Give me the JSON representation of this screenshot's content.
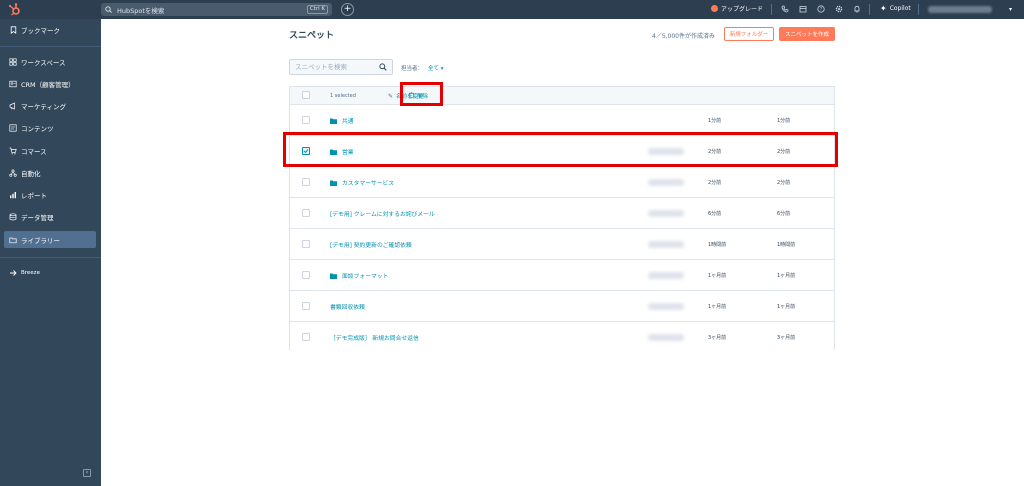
{
  "topbar": {
    "search_placeholder": "HubSpotを検索",
    "search_shortcut": "Ctrl K",
    "upgrade_label": "アップグレード",
    "copilot_label": "Copilot",
    "account_caret": "▾"
  },
  "sidebar": {
    "items": [
      {
        "label": "ブックマーク",
        "icon": "bookmark-icon"
      },
      {
        "label": "ワークスペース",
        "icon": "workspace-icon"
      },
      {
        "label": "CRM（顧客管理）",
        "icon": "crm-icon"
      },
      {
        "label": "マーケティング",
        "icon": "megaphone-icon"
      },
      {
        "label": "コンテンツ",
        "icon": "content-icon"
      },
      {
        "label": "コマース",
        "icon": "cart-icon"
      },
      {
        "label": "自動化",
        "icon": "automation-icon"
      },
      {
        "label": "レポート",
        "icon": "report-icon"
      },
      {
        "label": "データ管理",
        "icon": "database-icon"
      },
      {
        "label": "ライブラリー",
        "icon": "folder-icon"
      },
      {
        "label": "Breeze",
        "icon": "breeze-icon"
      }
    ],
    "active_index": 9
  },
  "page": {
    "title": "スニペット",
    "usage": "4／5,000件が作成済み",
    "new_folder_label": "新規フォルダー",
    "create_label": "スニペットを作成"
  },
  "filters": {
    "search_placeholder": "スニペットを検索",
    "owner_label": "担当者：",
    "owner_value": "全て ▾"
  },
  "table": {
    "selected_text": "1 selected",
    "rename_label": "名前を変更",
    "delete_label": "削除",
    "rows": [
      {
        "name": "共通",
        "folder": true,
        "checked": false,
        "created": "1分前",
        "updated": "1分前",
        "blurred": false
      },
      {
        "name": "営業",
        "folder": true,
        "checked": true,
        "created": "2分前",
        "updated": "2分前",
        "blurred": true
      },
      {
        "name": "カスタマーサービス",
        "folder": true,
        "checked": false,
        "created": "2分前",
        "updated": "2分前",
        "blurred": true
      },
      {
        "name": "[デモ用] クレームに対するお詫びメール",
        "folder": false,
        "checked": false,
        "created": "6分前",
        "updated": "6分前",
        "blurred": true
      },
      {
        "name": "[デモ用] 契約更新のご確認依頼",
        "folder": false,
        "checked": false,
        "created": "1時間前",
        "updated": "1時間前",
        "blurred": true
      },
      {
        "name": "面談フォーマット",
        "folder": true,
        "checked": false,
        "created": "1ヶ月前",
        "updated": "1ヶ月前",
        "blurred": true
      },
      {
        "name": "書類回収依頼",
        "folder": false,
        "checked": false,
        "created": "1ヶ月前",
        "updated": "1ヶ月前",
        "blurred": true
      },
      {
        "name": "［デモ完成版］ 新規お問合せ返信",
        "folder": false,
        "checked": false,
        "created": "3ヶ月前",
        "updated": "3ヶ月前",
        "blurred": true
      }
    ]
  },
  "colors": {
    "topbar": "#2d3e50",
    "sidebar": "#33475b",
    "accent": "#ff7a59",
    "link": "#0091ae",
    "highlight": "#e50000"
  }
}
